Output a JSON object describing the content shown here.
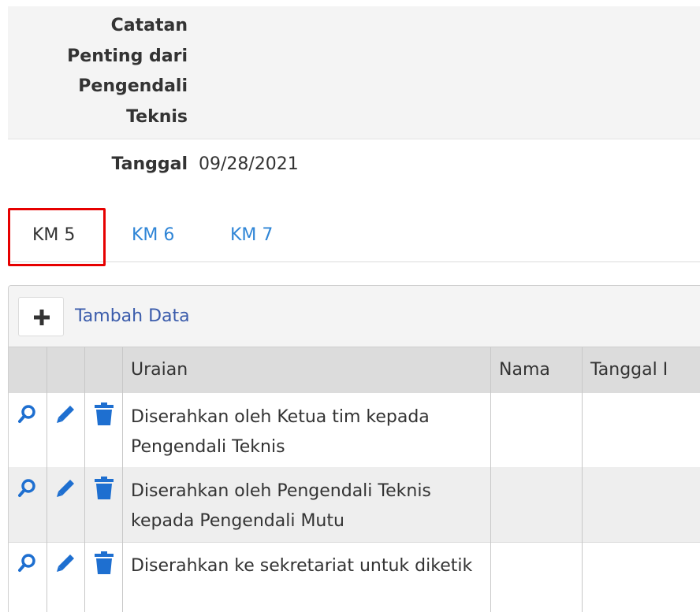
{
  "notes": {
    "label": "Catatan Penting dari Pengendali Teknis"
  },
  "date": {
    "label": "Tanggal",
    "value": "09/28/2021"
  },
  "tabs": [
    {
      "label": "KM 5",
      "active": true
    },
    {
      "label": "KM 6",
      "active": false
    },
    {
      "label": "KM 7",
      "active": false
    }
  ],
  "toolbar": {
    "add_label": "Tambah Data"
  },
  "table": {
    "columns": [
      "Uraian",
      "Nama",
      "Tanggal I"
    ],
    "rows": [
      {
        "uraian": "Diserahkan oleh Ketua tim kepada Pengendali Teknis",
        "nama": "",
        "tanggal": ""
      },
      {
        "uraian": "Diserahkan oleh Pengendali Teknis kepada Pengendali Mutu",
        "nama": "",
        "tanggal": ""
      },
      {
        "uraian": "Diserahkan ke sekretariat untuk diketik",
        "nama": "",
        "tanggal": ""
      }
    ]
  },
  "colors": {
    "link": "#2f85d6",
    "action_icon": "#1e6fd0",
    "highlight": "#e60000",
    "add_text": "#3a5bab"
  },
  "icons": [
    "plus-icon",
    "search-icon",
    "pencil-icon",
    "trash-icon"
  ]
}
